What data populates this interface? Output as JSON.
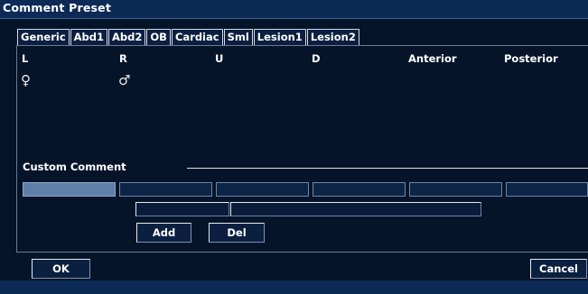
{
  "window": {
    "title": "Comment Preset"
  },
  "tabs": [
    {
      "label": "Generic",
      "active": true
    },
    {
      "label": "Abd1"
    },
    {
      "label": "Abd2"
    },
    {
      "label": "OB"
    },
    {
      "label": "Cardiac"
    },
    {
      "label": "Sml"
    },
    {
      "label": "Lesion1"
    },
    {
      "label": "Lesion2"
    }
  ],
  "preset_columns": [
    "L",
    "R",
    "U",
    "D",
    "Anterior",
    "Posterior"
  ],
  "symbols": {
    "female": "♀",
    "male": "♂"
  },
  "custom": {
    "section_label": "Custom  Comment",
    "add_label": "Add",
    "del_label": "Del"
  },
  "footer": {
    "ok_label": "OK",
    "cancel_label": "Cancel"
  },
  "colors": {
    "background": "#06142a",
    "titlebar": "#0d2a56",
    "selected_slot": "#5f7fa8"
  }
}
